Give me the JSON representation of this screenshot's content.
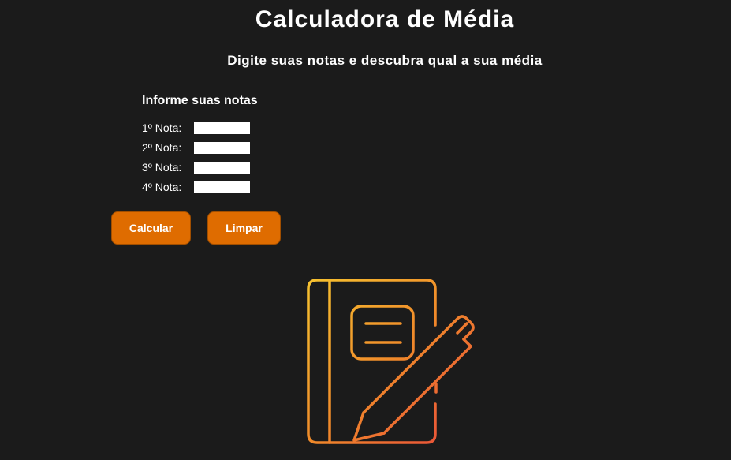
{
  "header": {
    "title": "Calculadora de Média",
    "subtitle": "Digite suas notas e descubra qual a sua média"
  },
  "form": {
    "heading": "Informe suas notas",
    "fields": [
      {
        "label": "1º Nota:",
        "value": ""
      },
      {
        "label": "2º Nota:",
        "value": ""
      },
      {
        "label": "3º Nota:",
        "value": ""
      },
      {
        "label": "4º Nota:",
        "value": ""
      }
    ]
  },
  "buttons": {
    "calculate": "Calcular",
    "clear": "Limpar"
  },
  "colors": {
    "background": "#1b1b1b",
    "button": "#df6c00",
    "icon_gradient_start": "#f7c530",
    "icon_gradient_end": "#e8453c"
  },
  "illustration": {
    "icon": "notebook-pencil-icon"
  }
}
